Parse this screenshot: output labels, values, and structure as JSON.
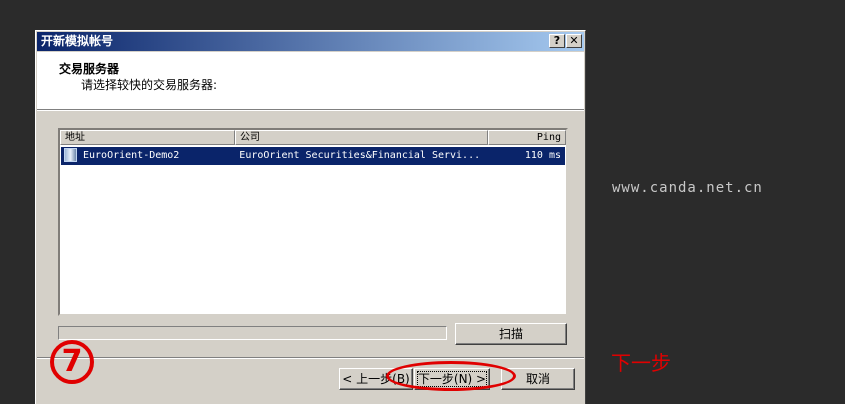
{
  "dialog": {
    "title": "开新模拟帐号",
    "help_btn": "?",
    "close_btn": "✕",
    "header_title": "交易服务器",
    "header_subtitle": "请选择较快的交易服务器:"
  },
  "server_list": {
    "columns": [
      "地址",
      "公司",
      "Ping"
    ],
    "rows": [
      {
        "address": "EuroOrient-Demo2",
        "company": "EuroOrient Securities&Financial Servi...",
        "ping": "110 ms"
      }
    ]
  },
  "buttons": {
    "scan": "扫描",
    "back": "< 上一步(B)",
    "next": "下一步(N) >",
    "cancel": "取消"
  },
  "annotations": {
    "step_number": "7",
    "next_hint": "下一步",
    "watermark": "www.canda.net.cn",
    "accent_color": "#e00000"
  }
}
